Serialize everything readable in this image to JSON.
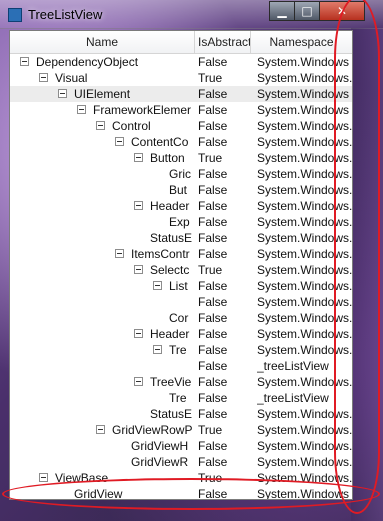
{
  "window": {
    "title": "TreeListView",
    "minimize": "▁",
    "maximize": "□",
    "close": "✕"
  },
  "columns": {
    "name": "Name",
    "is_abstract": "IsAbstract",
    "namespace": "Namespace"
  },
  "rows": [
    {
      "name": "DependencyObject",
      "level": 0,
      "expander": true,
      "abs": "False",
      "ns": "System.Windows"
    },
    {
      "name": "Visual",
      "level": 1,
      "expander": true,
      "abs": "True",
      "ns": "System.Windows."
    },
    {
      "name": "UIElement",
      "level": 2,
      "expander": true,
      "abs": "False",
      "ns": "System.Windows",
      "selected": true
    },
    {
      "name": "FrameworkElemer",
      "level": 3,
      "expander": true,
      "abs": "False",
      "ns": "System.Windows"
    },
    {
      "name": "Control",
      "level": 4,
      "expander": true,
      "abs": "False",
      "ns": "System.Windows."
    },
    {
      "name": "ContentCo",
      "level": 5,
      "expander": true,
      "abs": "False",
      "ns": "System.Windows."
    },
    {
      "name": "Button",
      "level": 6,
      "expander": true,
      "abs": "True",
      "ns": "System.Windows."
    },
    {
      "name": "Gric",
      "level": 7,
      "expander": false,
      "abs": "False",
      "ns": "System.Windows."
    },
    {
      "name": "But",
      "level": 7,
      "expander": false,
      "abs": "False",
      "ns": "System.Windows."
    },
    {
      "name": "Header",
      "level": 6,
      "expander": true,
      "abs": "False",
      "ns": "System.Windows."
    },
    {
      "name": "Exp",
      "level": 7,
      "expander": false,
      "abs": "False",
      "ns": "System.Windows."
    },
    {
      "name": "StatusE",
      "level": 6,
      "expander": false,
      "abs": "False",
      "ns": "System.Windows."
    },
    {
      "name": "ItemsContr",
      "level": 5,
      "expander": true,
      "abs": "False",
      "ns": "System.Windows."
    },
    {
      "name": "Selectc",
      "level": 6,
      "expander": true,
      "abs": "True",
      "ns": "System.Windows."
    },
    {
      "name": "List",
      "level": 7,
      "expander": true,
      "abs": "False",
      "ns": "System.Windows."
    },
    {
      "name": "",
      "level": 8,
      "expander": false,
      "abs": "False",
      "ns": "System.Windows."
    },
    {
      "name": "Cor",
      "level": 7,
      "expander": false,
      "abs": "False",
      "ns": "System.Windows."
    },
    {
      "name": "Header",
      "level": 6,
      "expander": true,
      "abs": "False",
      "ns": "System.Windows."
    },
    {
      "name": "Tre",
      "level": 7,
      "expander": true,
      "abs": "False",
      "ns": "System.Windows."
    },
    {
      "name": "",
      "level": 8,
      "expander": false,
      "abs": "False",
      "ns": "_treeListView"
    },
    {
      "name": "TreeVie",
      "level": 6,
      "expander": true,
      "abs": "False",
      "ns": "System.Windows."
    },
    {
      "name": "Tre",
      "level": 7,
      "expander": false,
      "abs": "False",
      "ns": "_treeListView"
    },
    {
      "name": "StatusE",
      "level": 6,
      "expander": false,
      "abs": "False",
      "ns": "System.Windows."
    },
    {
      "name": "GridViewRowP",
      "level": 4,
      "expander": true,
      "abs": "True",
      "ns": "System.Windows."
    },
    {
      "name": "GridViewH",
      "level": 5,
      "expander": false,
      "abs": "False",
      "ns": "System.Windows."
    },
    {
      "name": "GridViewR",
      "level": 5,
      "expander": false,
      "abs": "False",
      "ns": "System.Windows."
    },
    {
      "name": "ViewBase",
      "level": 1,
      "expander": true,
      "abs": "True",
      "ns": "System.Windows."
    },
    {
      "name": "GridView",
      "level": 2,
      "expander": false,
      "abs": "False",
      "ns": "System.Windows"
    }
  ],
  "annotation_color": "#e01b24"
}
